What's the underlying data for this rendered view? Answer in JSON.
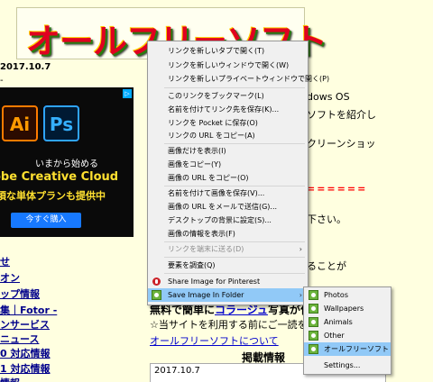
{
  "header": {
    "logo_text": "オールフリーソフト"
  },
  "left": {
    "date": "2017.10.7",
    "dash": "-",
    "links": [
      "せ",
      "オン",
      "ップ情報",
      "集｜Fotor -",
      "ンサービス",
      "ニュース",
      "0 対応情報",
      "1 対応情報",
      "情報"
    ]
  },
  "ad": {
    "ai": "Ai",
    "ps": "Ps",
    "tagline": "いまから始める",
    "product": "obe Creative Cloud",
    "promo": "頃な単体プランも提供中",
    "button": "今すぐ購入",
    "adchoice": "▷"
  },
  "right": {
    "l1": "dows OS",
    "l2": "ソフトを紹介し",
    "l3": "クリーンショッ",
    "l4": "======",
    "l5": "下さい。",
    "l6": "ることが"
  },
  "middle": {
    "free_text_a": "無料で簡単に",
    "free_text_link": "コラージュ",
    "free_text_b": "写真が作れ",
    "notice": "☆当サイトを利用する前にご一読を",
    "about_link": "オールフリーソフトについて",
    "section_title": "掲載情報",
    "info_date": "2017.10.7"
  },
  "context_menu": {
    "items": [
      {
        "label": "リンクを新しいタブで開く(T)"
      },
      {
        "label": "リンクを新しいウィンドウで開く(W)"
      },
      {
        "label": "リンクを新しいプライベートウィンドウで開く(P)"
      },
      {
        "label": "このリンクをブックマーク(L)"
      },
      {
        "label": "名前を付けてリンク先を保存(K)..."
      },
      {
        "label": "リンクを Pocket に保存(O)"
      },
      {
        "label": "リンクの URL をコピー(A)"
      },
      {
        "label": "画像だけを表示(I)"
      },
      {
        "label": "画像をコピー(Y)"
      },
      {
        "label": "画像の URL をコピー(O)"
      },
      {
        "label": "名前を付けて画像を保存(V)..."
      },
      {
        "label": "画像の URL をメールで送信(G)..."
      },
      {
        "label": "デスクトップの背景に設定(S)..."
      },
      {
        "label": "画像の情報を表示(F)"
      },
      {
        "label": "リンクを端末に送る(D)"
      },
      {
        "label": "要素を調査(Q)"
      },
      {
        "label": "Share Image for Pinterest"
      },
      {
        "label": "Save Image In Folder"
      }
    ]
  },
  "submenu": {
    "items": [
      "Photos",
      "Wallpapers",
      "Animals",
      "Other",
      "オールフリーソフト",
      "Settings..."
    ]
  },
  "colors": {
    "highlight": "#91c9f7",
    "page_bg": "#ffffe0",
    "link": "#00008b"
  }
}
